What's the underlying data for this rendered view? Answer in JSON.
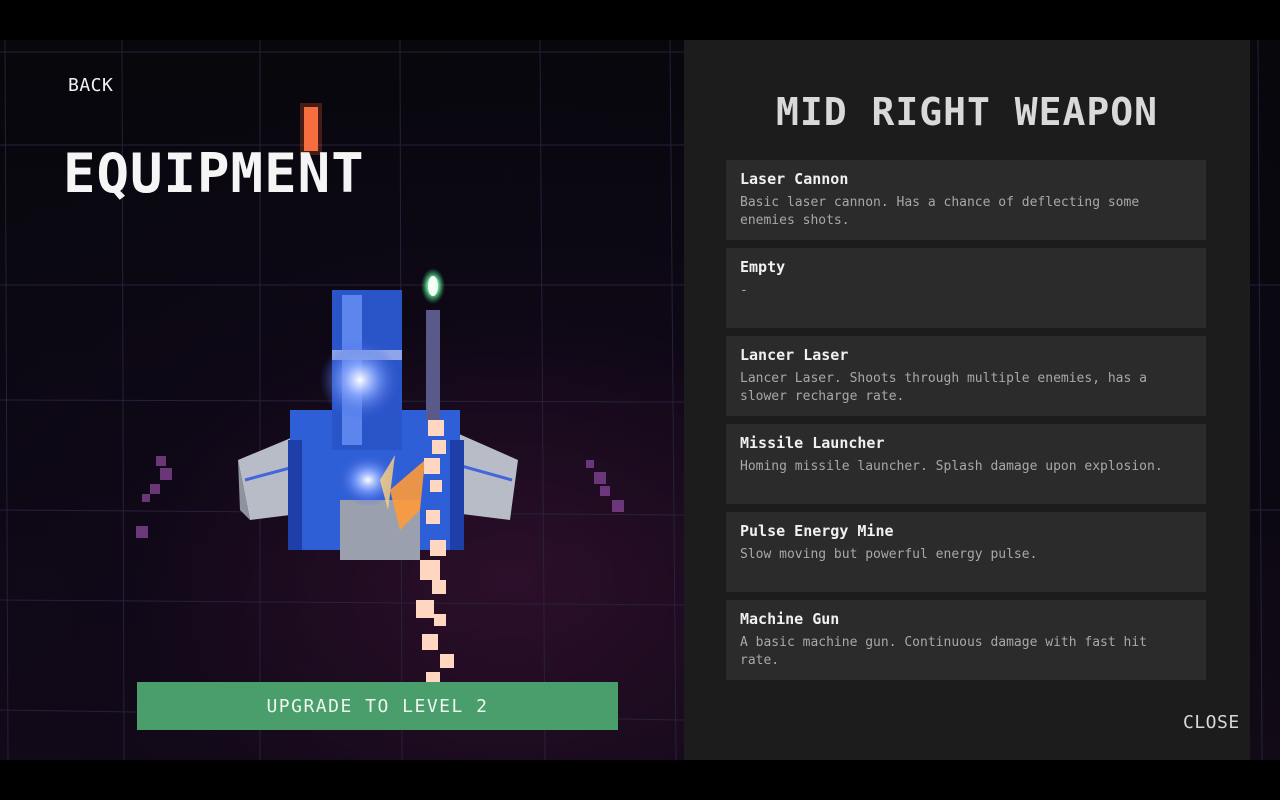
{
  "nav": {
    "back_label": "BACK"
  },
  "screen": {
    "title": "EQUIPMENT"
  },
  "upgrade": {
    "label": "UPGRADE TO LEVEL 2"
  },
  "panel": {
    "title": "MID RIGHT WEAPON",
    "weapons": [
      {
        "name": "Laser Cannon",
        "description": "Basic laser cannon. Has a chance of deflecting some enemies shots."
      },
      {
        "name": "Empty",
        "description": "-"
      },
      {
        "name": "Lancer Laser",
        "description": "Lancer Laser. Shoots through multiple enemies, has a slower recharge rate."
      },
      {
        "name": "Missile Launcher",
        "description": "Homing missile launcher. Splash damage upon explosion."
      },
      {
        "name": "Pulse Energy Mine",
        "description": "Slow moving but powerful energy pulse."
      },
      {
        "name": "Machine Gun",
        "description": "A basic machine gun. Continuous damage with fast hit rate."
      }
    ],
    "close_label": "CLOSE"
  },
  "colors": {
    "upgrade_button": "#4a9e6b",
    "panel_bg": "#1c1c1c",
    "item_bg": "#2b2b2b",
    "ship_blue": "#2f5fd6",
    "ship_gray": "#b8bcc6",
    "exhaust": "#ffd7c0"
  }
}
